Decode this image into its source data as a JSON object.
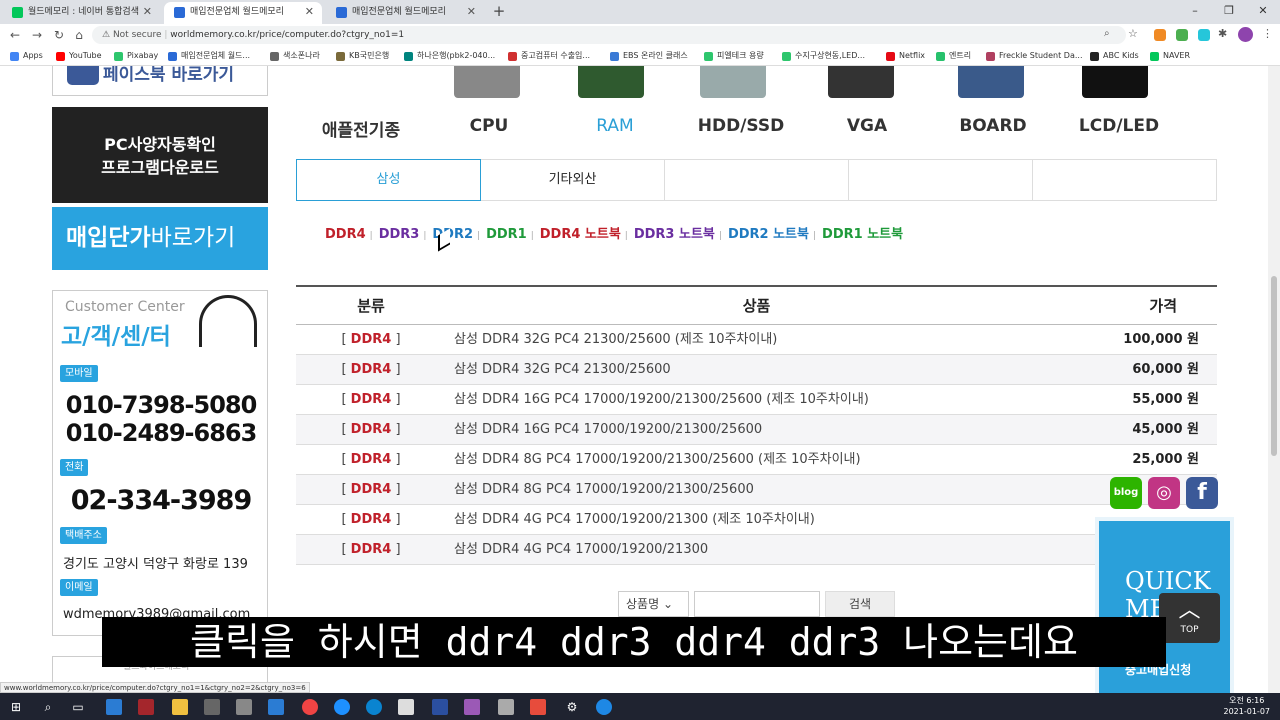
{
  "browser": {
    "tabs": [
      {
        "label": "월드메모리 : 네이버 통합검색",
        "icon_color": "#03c75a",
        "active": false
      },
      {
        "label": "매입전문업체 월드메모리",
        "icon_color": "#2a6ad6",
        "active": true
      },
      {
        "label": "매입전문업체 월드메모리",
        "icon_color": "#2a6ad6",
        "active": false
      }
    ],
    "new_tab": "+",
    "window_controls": [
      "–",
      "❐",
      "✕"
    ],
    "nav": {
      "back": "←",
      "forward": "→",
      "reload": "↻",
      "home": "⌂"
    },
    "security": "Not secure",
    "url": "worldmemory.co.kr/price/computer.do?ctgry_no1=1",
    "bookmarks": [
      {
        "label": "Apps",
        "color": "#4285f4"
      },
      {
        "label": "YouTube",
        "color": "#ff0000"
      },
      {
        "label": "Pixabay",
        "color": "#2ec66d"
      },
      {
        "label": "매입전문업체 월드...",
        "color": "#2a6ad6"
      },
      {
        "label": "색소폰나라",
        "color": "#666666"
      },
      {
        "label": "KB국민은행",
        "color": "#7a6a3a"
      },
      {
        "label": "하나은행(pbk2-040...",
        "color": "#00847e"
      },
      {
        "label": "중고컴퓨터 수출입...",
        "color": "#d03030"
      },
      {
        "label": "EBS 온라인 클래스",
        "color": "#3a7ad6"
      },
      {
        "label": "피엘테크 용량",
        "color": "#2ec66d"
      },
      {
        "label": "수지구상현동,LED...",
        "color": "#2ec66d"
      },
      {
        "label": "Netflix",
        "color": "#e50914"
      },
      {
        "label": "엔트리",
        "color": "#27c16c"
      },
      {
        "label": "Freckle Student Da...",
        "color": "#b04060"
      },
      {
        "label": "ABC Kids",
        "color": "#222222"
      },
      {
        "label": "NAVER",
        "color": "#03c75a"
      }
    ]
  },
  "sidebar": {
    "facebook_banner": "페이스북 바로가기",
    "pc_banner": [
      "PC사양자동확인",
      "프로그램다운로드"
    ],
    "price_banner": {
      "bold": "매입단가",
      "light": "바로가기"
    },
    "customer_center": {
      "title_en": "Customer Center",
      "title_kr": "고/객/센/터",
      "mobile_label": "모바일",
      "mobile_numbers": [
        "010-7398-5080",
        "010-2489-6863"
      ],
      "phone_label": "전화",
      "phone_number": "02-334-3989",
      "address_label": "택배주소",
      "address": "경기도 고양시 덕양구 화랑로 139",
      "email_label": "이메일",
      "email": "wdmemory3989@gmail.com"
    },
    "next_box": "월드와이드메모리"
  },
  "categories": [
    {
      "label": "애플전기종",
      "active": false
    },
    {
      "label": "CPU",
      "active": false
    },
    {
      "label": "RAM",
      "active": true
    },
    {
      "label": "HDD/SSD",
      "active": false
    },
    {
      "label": "VGA",
      "active": false
    },
    {
      "label": "BOARD",
      "active": false
    },
    {
      "label": "LCD/LED",
      "active": false
    }
  ],
  "subtabs": [
    {
      "label": "삼성",
      "active": true
    },
    {
      "label": "기타외산",
      "active": false
    },
    {
      "label": "",
      "active": false
    },
    {
      "label": "",
      "active": false
    },
    {
      "label": "",
      "active": false
    }
  ],
  "filters": [
    {
      "label": "DDR4",
      "color": "#c0202a"
    },
    {
      "label": "DDR3",
      "color": "#6a2ea0"
    },
    {
      "label": "DDR2",
      "color": "#1f7ac0"
    },
    {
      "label": "DDR1",
      "color": "#1f9a3a"
    },
    {
      "label": "DDR4 노트북",
      "color": "#c0202a"
    },
    {
      "label": "DDR3 노트북",
      "color": "#6a2ea0"
    },
    {
      "label": "DDR2 노트북",
      "color": "#1f7ac0"
    },
    {
      "label": "DDR1 노트북",
      "color": "#1f9a3a"
    }
  ],
  "filter_separator": "|",
  "table": {
    "headers": {
      "category": "분류",
      "product": "상품",
      "price": "가격"
    },
    "rows": [
      {
        "tag": "DDR4",
        "product": "삼성 DDR4 32G PC4 21300/25600 (제조 10주차이내)",
        "price": "100,000 원"
      },
      {
        "tag": "DDR4",
        "product": "삼성 DDR4 32G PC4 21300/25600",
        "price": "60,000 원"
      },
      {
        "tag": "DDR4",
        "product": "삼성 DDR4 16G PC4 17000/19200/21300/25600 (제조 10주차이내)",
        "price": "55,000 원"
      },
      {
        "tag": "DDR4",
        "product": "삼성 DDR4 16G PC4 17000/19200/21300/25600",
        "price": "45,000 원"
      },
      {
        "tag": "DDR4",
        "product": "삼성 DDR4 8G PC4 17000/19200/21300/25600 (제조 10주차이내)",
        "price": "25,000 원"
      },
      {
        "tag": "DDR4",
        "product": "삼성 DDR4 8G PC4 17000/19200/21300/25600",
        "price": ""
      },
      {
        "tag": "DDR4",
        "product": "삼성 DDR4 4G PC4 17000/19200/21300 (제조 10주차이내)",
        "price": ""
      },
      {
        "tag": "DDR4",
        "product": "삼성 DDR4 4G PC4 17000/19200/21300",
        "price": ""
      }
    ]
  },
  "search": {
    "select_value": "상품명",
    "input_value": "",
    "button": "검색"
  },
  "social": {
    "blog": "blog",
    "instagram": "◎",
    "facebook": "f"
  },
  "quick_menu": {
    "title": [
      "QUICK",
      "ME"
    ],
    "subtitle": "중고매입신청"
  },
  "top_button": "TOP",
  "subtitle_overlay": "클릭을 하시면 ddr4 ddr3 ddr4 ddr3 나오는데요",
  "status_url": "www.worldmemory.co.kr/price/computer.do?ctgry_no1=1&ctgry_no2=2&ctgry_no3=6",
  "taskbar": {
    "time": "오전 6:16",
    "date": "2021-01-07"
  }
}
